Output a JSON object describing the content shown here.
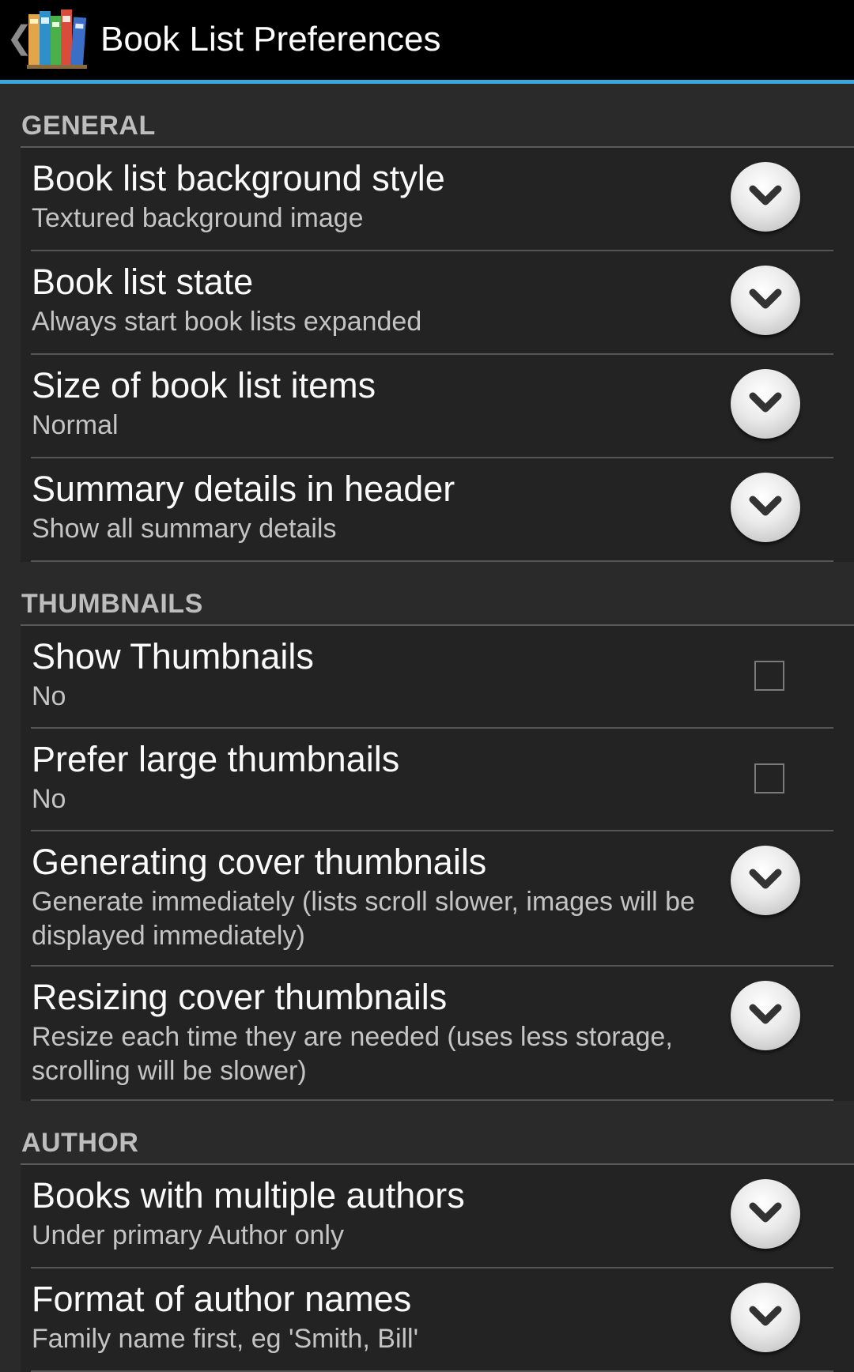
{
  "actionbar": {
    "title": "Book List Preferences",
    "icon": "books-app-icon",
    "back_icon": "chevron-left-icon"
  },
  "colors": {
    "accent": "#3aa8e0",
    "background": "#2a2a2b",
    "actionbar": "#000000"
  },
  "sections": {
    "general": {
      "header": "GENERAL",
      "items": [
        {
          "title": "Book list background style",
          "summary": "Textured background image",
          "control": "dropdown"
        },
        {
          "title": "Book list state",
          "summary": "Always start book lists expanded",
          "control": "dropdown"
        },
        {
          "title": "Size of book list items",
          "summary": "Normal",
          "control": "dropdown"
        },
        {
          "title": "Summary details in header",
          "summary": "Show all summary details",
          "control": "dropdown"
        }
      ]
    },
    "thumbnails": {
      "header": "THUMBNAILS",
      "items": [
        {
          "title": "Show Thumbnails",
          "summary": "No",
          "control": "checkbox",
          "checked": false
        },
        {
          "title": "Prefer large thumbnails",
          "summary": "No",
          "control": "checkbox",
          "checked": false
        },
        {
          "title": "Generating cover thumbnails",
          "summary": "Generate immediately (lists scroll slower, images will be displayed immediately)",
          "control": "dropdown"
        },
        {
          "title": "Resizing cover thumbnails",
          "summary": "Resize each time they are needed (uses less storage, scrolling will be slower)",
          "control": "dropdown"
        }
      ]
    },
    "author": {
      "header": "AUTHOR",
      "items": [
        {
          "title": "Books with multiple authors",
          "summary": "Under primary Author only",
          "control": "dropdown"
        },
        {
          "title": "Format of author names",
          "summary": "Family name first, eg 'Smith, Bill'",
          "control": "dropdown"
        }
      ]
    }
  }
}
